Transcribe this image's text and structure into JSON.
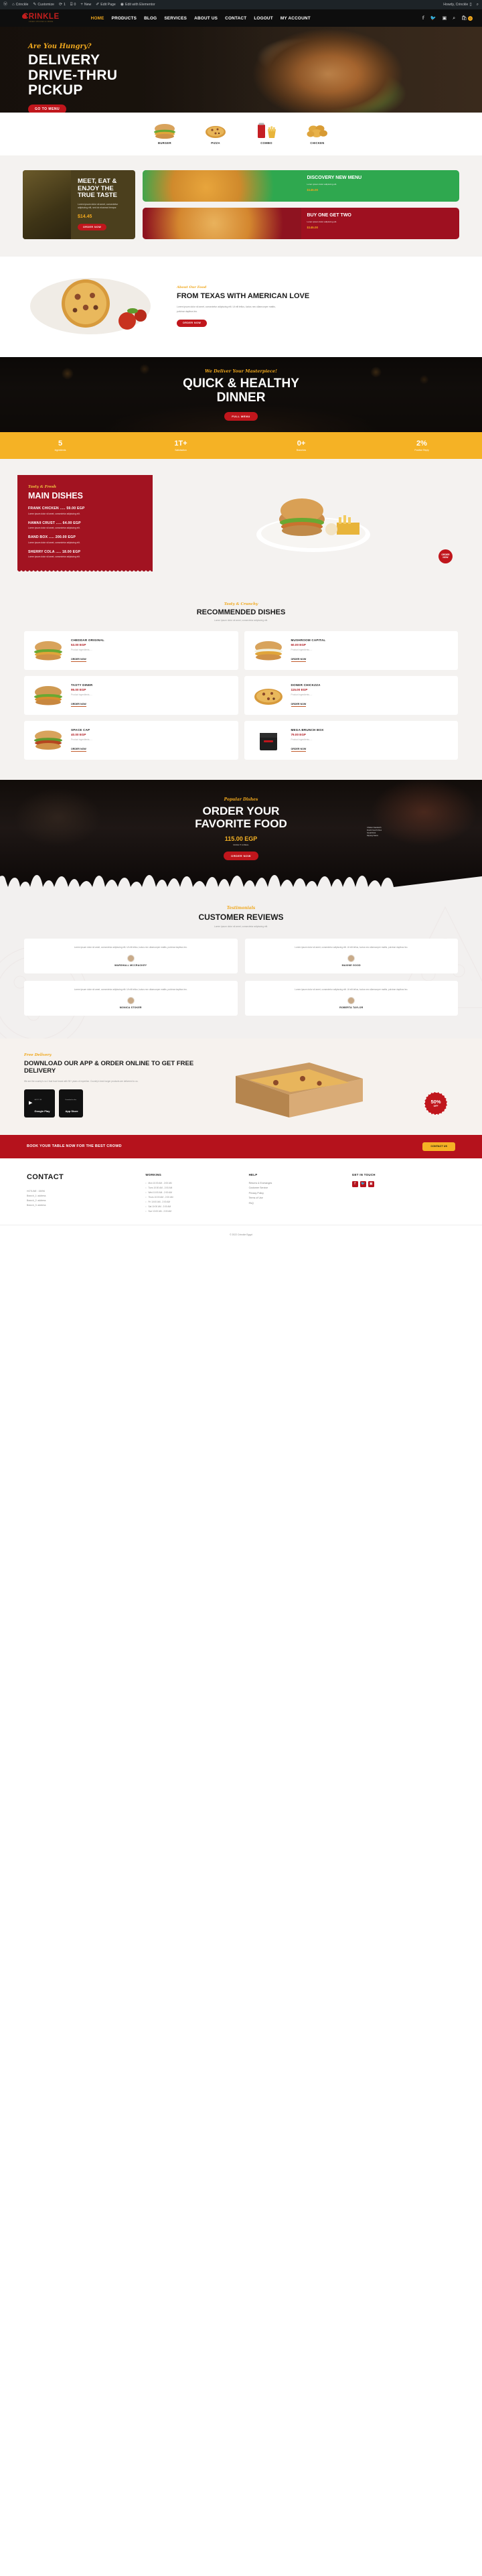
{
  "admin_bar": {
    "items": [
      {
        "icon": "wordpress-icon",
        "label": ""
      },
      {
        "icon": "home-icon",
        "label": "Crinckle"
      },
      {
        "icon": "customize-icon",
        "label": "Customize"
      },
      {
        "icon": "updates-icon",
        "label": "1"
      },
      {
        "icon": "comments-icon",
        "label": "0"
      },
      {
        "icon": "plus-icon",
        "label": "New"
      },
      {
        "icon": "pencil-icon",
        "label": "Edit Page"
      },
      {
        "icon": "elementor-icon",
        "label": "Edit with Elementor"
      }
    ],
    "howdy": "Howdy, Crinckle",
    "search_icon": "search-icon"
  },
  "header": {
    "logo": {
      "text": "CRINKLE",
      "tagline": "FRIED CHICKEN & MORE"
    },
    "menu": [
      {
        "label": "HOME",
        "active": true
      },
      {
        "label": "PRODUCTS",
        "active": false
      },
      {
        "label": "BLOG",
        "active": false
      },
      {
        "label": "SERVICES",
        "active": false
      },
      {
        "label": "ABOUT US",
        "active": false
      },
      {
        "label": "CONTACT",
        "active": false
      },
      {
        "label": "LOGOUT",
        "active": false
      },
      {
        "label": "MY ACCOUNT",
        "active": false
      }
    ],
    "icons": [
      "facebook-icon",
      "twitter-icon",
      "instagram-icon",
      "search-icon",
      "cart-icon"
    ],
    "cart_count": "0"
  },
  "hero": {
    "eyebrow": "Are You Hungry?",
    "title_lines": [
      "DELIVERY",
      "DRIVE-THRU",
      "PICKUP"
    ],
    "cta": "GO TO MENU"
  },
  "categories": [
    {
      "label": "BURGER",
      "icon": "burger-icon"
    },
    {
      "label": "PIZZA",
      "icon": "pizza-icon"
    },
    {
      "label": "COMBO",
      "icon": "combo-icon"
    },
    {
      "label": "CHICKEN",
      "icon": "chicken-icon"
    }
  ],
  "promo": {
    "main": {
      "title": "MEET, EAT & ENJOY THE TRUE TASTE",
      "desc": "Lorem ipsum dolor sit amet, consectetur adipiscing elit, sed do eiusmod tempor.",
      "price": "$14.45",
      "cta": "ORDER NOW"
    },
    "cards": [
      {
        "title": "DISCOVERY NEW MENU",
        "desc": "Lorem ipsum dolor adipiscing elit.",
        "price": "$145.00",
        "color": "#2fa84f"
      },
      {
        "title": "BUY ONE GET TWO",
        "desc": "Lorem ipsum dolor adipiscing elit.",
        "price": "$145.00",
        "color": "#9e1020"
      }
    ]
  },
  "about": {
    "eyebrow": "About Our Food",
    "title": "FROM TEXAS WITH AMERICAN LOVE",
    "desc": "Lorem ipsum dolor sit amet, consectetur adipiscing elit. Ut elit tellus, luctus nec ullamcorper mattis, pulvinar dapibus leo.",
    "cta": "ORDER NOW"
  },
  "banner": {
    "eyebrow": "We Deliver Your Masterpiece!",
    "title_lines": [
      "QUICK & HEALTHY",
      "DINNER"
    ],
    "cta": "FULL MENU"
  },
  "stats": [
    {
      "value": "5",
      "label": "Ingredients"
    },
    {
      "value": "1T+",
      "label": "Satisfaction"
    },
    {
      "value": "0+",
      "label": "Branches"
    },
    {
      "value": "2%",
      "label": "Positive Reply"
    }
  ],
  "main_dishes": {
    "eyebrow": "Tasty & Fresh",
    "title": "MAIN DISHES",
    "desc_default": "Lorem ipsum dolor sit amet, consectetur adipiscing elit.",
    "items": [
      {
        "name": "FRANK CHICKEN ..... 59.00 EGP"
      },
      {
        "name": "HAWAII CRUST ..... 64.00 EGP"
      },
      {
        "name": "BAND BOX ..... 200.00 EGP"
      },
      {
        "name": "SHERRY COLA ..... 18.00 EGP"
      }
    ],
    "badge": "ORDER NOW"
  },
  "recommended": {
    "eyebrow": "Tasty & Crunchy",
    "title": "RECOMMENDED DISHES",
    "desc": "Lorem ipsum dolor sit amet, consectetur adipiscing elit.",
    "ingredients_label": "Product ingredients.....",
    "order_label": "ORDER NOW",
    "items": [
      {
        "name": "CHEDDAR ORIGINAL",
        "price": "53.00 EGP",
        "icon": "burger-icon"
      },
      {
        "name": "MUSHROOM CAPITAL",
        "price": "60.00 EGP",
        "icon": "burger-icon"
      },
      {
        "name": "TASTY DINER",
        "price": "95.00 EGP",
        "icon": "burger-icon"
      },
      {
        "name": "DONER CHICKZZA",
        "price": "115.00 EGP",
        "icon": "pizza-icon"
      },
      {
        "name": "SPACE CAP",
        "price": "40.00 EGP",
        "icon": "burger-icon"
      },
      {
        "name": "MEGA BRUNCH BOX",
        "price": "79.00 EGP",
        "icon": "box-icon"
      }
    ]
  },
  "order_banner": {
    "eyebrow": "Popular Dishes",
    "title_lines": [
      "ORDER YOUR",
      "FAVORITE FOOD"
    ],
    "price": "115.00 EGP",
    "price_label": "MAKE IT A MEAL",
    "spec_lines": [
      "Chicken Sandwich",
      "Fresh French Fries",
      "Small Drink",
      "Dipping Sauce"
    ],
    "cta": "ORDER NOW"
  },
  "testimonials": {
    "eyebrow": "Testimonials",
    "title": "CUSTOMER REVIEWS",
    "desc": "Lorem ipsum dolor sit amet, consectetur adipiscing elit.",
    "items": [
      {
        "quote": "Lorem ipsum dolor sit amet, consectetur adipiscing elit. Ut elit tellus, luctus nec ullamcorper mattis, pulvinar dapibus leo.",
        "name": "MARSHALL MCCRACKEY"
      },
      {
        "quote": "Lorem ipsum dolor sit amet, consectetur adipiscing elit. Ut elit tellus, luctus nec ullamcorper mattis, pulvinar dapibus leo.",
        "name": "MAXINE GOOD"
      },
      {
        "quote": "Lorem ipsum dolor sit amet, consectetur adipiscing elit. Ut elit tellus, luctus nec ullamcorper mattis, pulvinar dapibus leo.",
        "name": "MONICA STOKER"
      },
      {
        "quote": "Lorem ipsum dolor sit amet, consectetur adipiscing elit. Ut elit tellus, luctus nec ullamcorper mattis, pulvinar dapibus leo.",
        "name": "ROBERTA TAYLOR"
      }
    ]
  },
  "app": {
    "eyebrow": "Free Delivery",
    "title": "DOWNLOAD OUR APP & ORDER ONLINE TO GET FREE DELIVERY",
    "desc": "We are the country's no.1 fast food brand with 90+ years of expertise. Country's best burger products are delivered to us.",
    "stores": [
      {
        "icon": "google-play-icon",
        "small": "GET IT ON",
        "big": "Google Play"
      },
      {
        "icon": "apple-icon",
        "small": "Download on the",
        "big": "App Store"
      }
    ],
    "offer": {
      "percent": "50%",
      "label": "OFF"
    }
  },
  "book_strip": {
    "text": "BOOK YOUR TABLE NOW FOR THE BEST CROWD",
    "cta": "CONTACT US"
  },
  "footer": {
    "contact": {
      "title": "CONTACT",
      "lines": [
        "HOTLINE : 15096",
        "Branch_1: address",
        "Branch_2: address",
        "Branch_3: address"
      ]
    },
    "working": {
      "title": "WORKING",
      "items": [
        "Mon 10:00 AM - 2:00 AM",
        "Tues 10:00 AM - 2:00 AM",
        "Wed 10:00 AM - 2:00 AM",
        "Thurs 10:00 AM - 2:00 AM",
        "Fri 10:00 AM - 2:00 AM",
        "Sat 10:00 AM - 2:00 AM",
        "Sun 10:00 AM - 2:00 AM"
      ]
    },
    "help": {
      "title": "HELP",
      "links": [
        "Returns & Exchanges",
        "Customer Service",
        "Privacy Policy",
        "Terms of Use",
        "FAQ"
      ]
    },
    "touch": {
      "title": "GET IN TOUCH",
      "icons": [
        "facebook-icon",
        "twitter-icon",
        "instagram-icon"
      ]
    },
    "copyright": "© 2022 Crinckle Egypt"
  }
}
